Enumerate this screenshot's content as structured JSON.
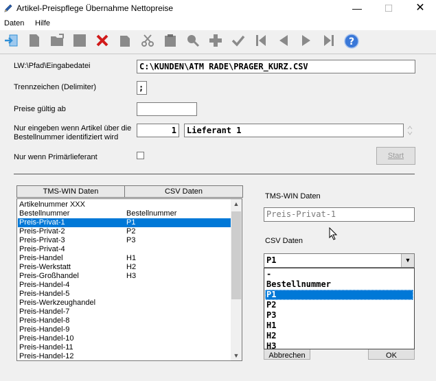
{
  "window": {
    "title": "Artikel-Preispflege Übernahme Nettopreise"
  },
  "menu": {
    "items": [
      "Daten",
      "Hilfe"
    ]
  },
  "form": {
    "path_label": "LW:\\Pfad\\Eingabedatei",
    "path_value": "C:\\KUNDEN\\ATM RADE\\PRAGER_KURZ.CSV",
    "delimiter_label": "Trennzeichen (Delimiter)",
    "delimiter_value": ";",
    "valid_from_label": "Preise gültig ab",
    "valid_from_value": "",
    "supplier_label_line1": "Nur eingeben wenn Artikel über die",
    "supplier_label_line2": "Bestellnummer identifiziert wird",
    "supplier_number": "1",
    "supplier_name": "Lieferant 1",
    "primary_label": "Nur wenn Primärlieferant",
    "start_label": "Start"
  },
  "grid": {
    "headers": [
      "TMS-WIN Daten",
      "CSV Daten"
    ],
    "rows": [
      {
        "tms": "Artikelnummer  XXX",
        "csv": ""
      },
      {
        "tms": "Bestellnummer",
        "csv": "Bestellnummer"
      },
      {
        "tms": "Preis-Privat-1",
        "csv": "P1"
      },
      {
        "tms": "Preis-Privat-2",
        "csv": "P2"
      },
      {
        "tms": "Preis-Privat-3",
        "csv": "P3"
      },
      {
        "tms": "Preis-Privat-4",
        "csv": ""
      },
      {
        "tms": "Preis-Handel",
        "csv": "H1"
      },
      {
        "tms": "Preis-Werkstatt",
        "csv": "H2"
      },
      {
        "tms": "Preis-Großhandel",
        "csv": "H3"
      },
      {
        "tms": "Preis-Handel-4",
        "csv": ""
      },
      {
        "tms": "Preis-Handel-5",
        "csv": ""
      },
      {
        "tms": "Preis-Werkzeughandel",
        "csv": ""
      },
      {
        "tms": "Preis-Handel-7",
        "csv": ""
      },
      {
        "tms": "Preis-Handel-8",
        "csv": ""
      },
      {
        "tms": "Preis-Handel-9",
        "csv": ""
      },
      {
        "tms": "Preis-Handel-10",
        "csv": ""
      },
      {
        "tms": "Preis-Handel-11",
        "csv": ""
      },
      {
        "tms": "Preis-Handel-12",
        "csv": ""
      }
    ],
    "selected_index": 2
  },
  "detail": {
    "tms_label": "TMS-WIN Daten",
    "tms_value": "Preis-Privat-1",
    "csv_label": "CSV Daten",
    "csv_value": "P1",
    "options": [
      "-",
      "Bestellnummer",
      "P1",
      "P2",
      "P3",
      "H1",
      "H2",
      "H3"
    ],
    "selected_option": 2,
    "cancel_label": "Abbrechen",
    "ok_label": "OK"
  },
  "icons": [
    "exit-icon",
    "new-icon",
    "open-icon",
    "save-icon",
    "delete-icon",
    "copy-icon",
    "cut-icon",
    "paste-icon",
    "search-icon",
    "add-icon",
    "check-icon",
    "first-icon",
    "prev-icon",
    "next-icon",
    "last-icon",
    "help-icon"
  ],
  "colors": {
    "selection": "#0078d7",
    "delete_icon": "#d11a1a",
    "exit_icon": "#2f8fd6",
    "help_icon": "#3a78d8"
  }
}
